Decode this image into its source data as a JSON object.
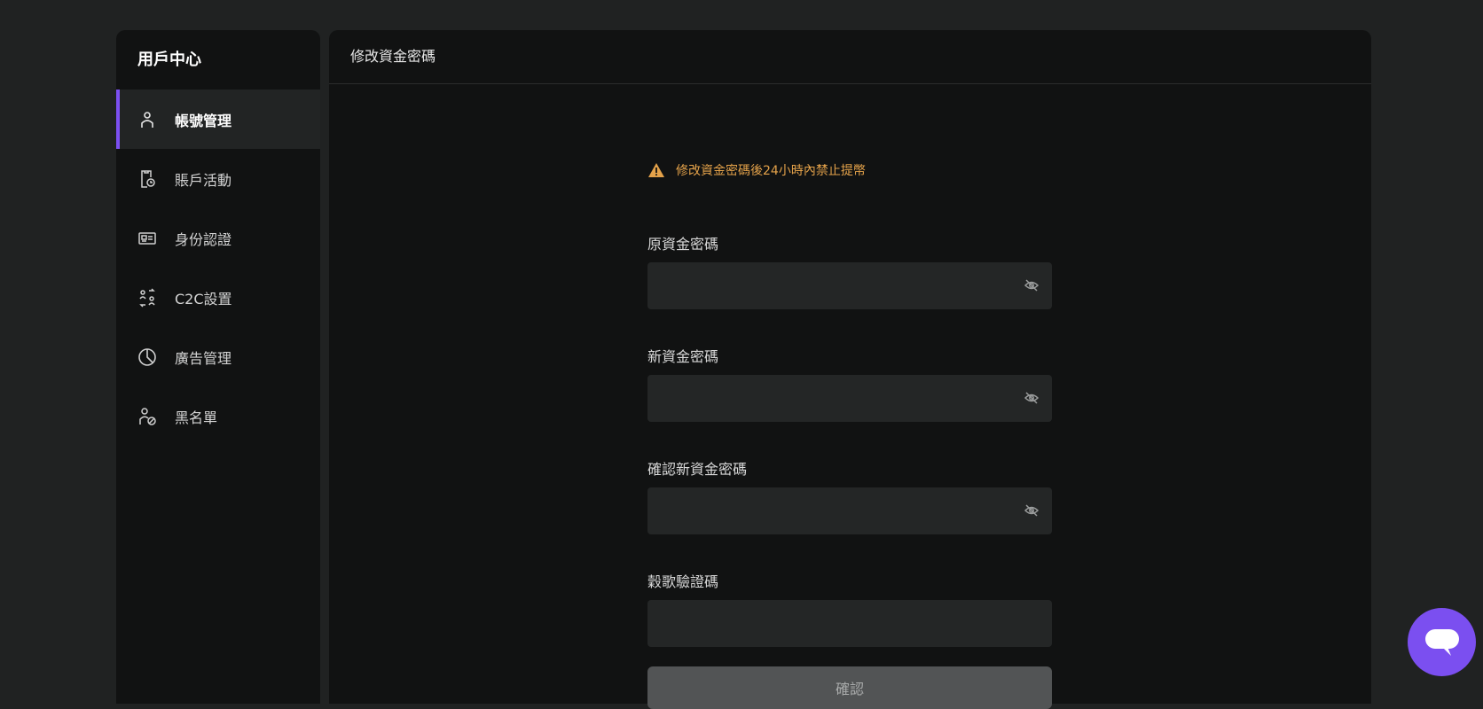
{
  "sidebar": {
    "title": "用戶中心",
    "items": [
      {
        "label": "帳號管理",
        "icon": "user-icon",
        "active": true
      },
      {
        "label": "賬戶活動",
        "icon": "activity-log-icon",
        "active": false
      },
      {
        "label": "身份認證",
        "icon": "id-card-icon",
        "active": false
      },
      {
        "label": "C2C設置",
        "icon": "c2c-exchange-icon",
        "active": false
      },
      {
        "label": "廣告管理",
        "icon": "pie-chart-icon",
        "active": false
      },
      {
        "label": "黑名單",
        "icon": "blocked-user-icon",
        "active": false
      }
    ]
  },
  "main": {
    "header_title": "修改資金密碼",
    "warning": "修改資金密碼後24小時內禁止提幣",
    "fields": [
      {
        "label": "原資金密碼",
        "value": "",
        "has_eye": true
      },
      {
        "label": "新資金密碼",
        "value": "",
        "has_eye": true
      },
      {
        "label": "確認新資金密碼",
        "value": "",
        "has_eye": true
      },
      {
        "label": "穀歌驗證碼",
        "value": "",
        "has_eye": false
      }
    ],
    "confirm_label": "確認"
  },
  "colors": {
    "accent": "#7b4ff0",
    "warning": "#e4a24a",
    "background": "#202222",
    "panel": "#111212"
  }
}
